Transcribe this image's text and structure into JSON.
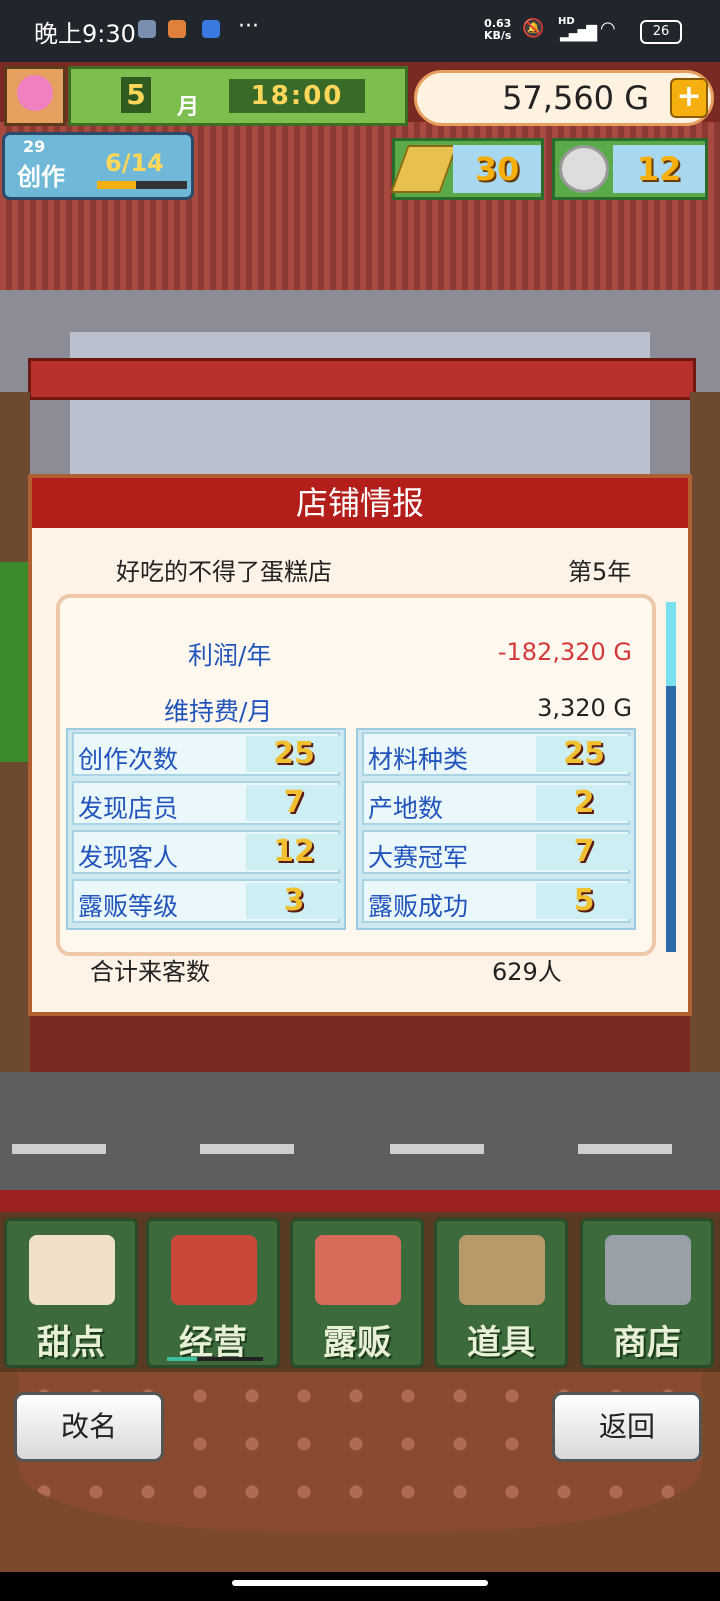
{
  "status_bar": {
    "time": "晚上9:30",
    "more": "···",
    "net_speed": "0.63",
    "net_unit": "KB/s",
    "signal_label": "HD",
    "battery": "26"
  },
  "hud": {
    "month": "5",
    "month_label": "月",
    "clock": "18:00",
    "money": "57,560 G",
    "create_counter": "29",
    "create_label": "创作",
    "create_progress": "6/14",
    "create_progress_fraction": 0.43,
    "gold_bars": "30",
    "medals": "12"
  },
  "dialog": {
    "title": "店铺情报",
    "shop_name": "好吃的不得了蛋糕店",
    "year": "第5年",
    "profit_label": "利润/年",
    "profit_value": "-182,320 G",
    "upkeep_label": "维持费/月",
    "upkeep_value": "3,320 G",
    "left_stats": [
      {
        "label": "创作次数",
        "value": "25"
      },
      {
        "label": "发现店员",
        "value": "7"
      },
      {
        "label": "发现客人",
        "value": "12"
      },
      {
        "label": "露贩等级",
        "value": "3"
      }
    ],
    "right_stats": [
      {
        "label": "材料种类",
        "value": "25"
      },
      {
        "label": "产地数",
        "value": "2"
      },
      {
        "label": "大赛冠军",
        "value": "7"
      },
      {
        "label": "露贩成功",
        "value": "5"
      }
    ],
    "total_label": "合计来客数",
    "total_value": "629人"
  },
  "menu": [
    {
      "label": "甜点",
      "icon": "cake-icon"
    },
    {
      "label": "经营",
      "icon": "shop-icon"
    },
    {
      "label": "露贩",
      "icon": "food-truck-icon"
    },
    {
      "label": "道具",
      "icon": "gear-bag-icon"
    },
    {
      "label": "商店",
      "icon": "cart-icon"
    }
  ],
  "footer": {
    "rename": "改名",
    "back": "返回"
  },
  "colors": {
    "title_red": "#b41e1a",
    "stat_blue": "#2255bb",
    "profit_red": "#d23a3a",
    "menu_green": "#3d6a3d"
  }
}
